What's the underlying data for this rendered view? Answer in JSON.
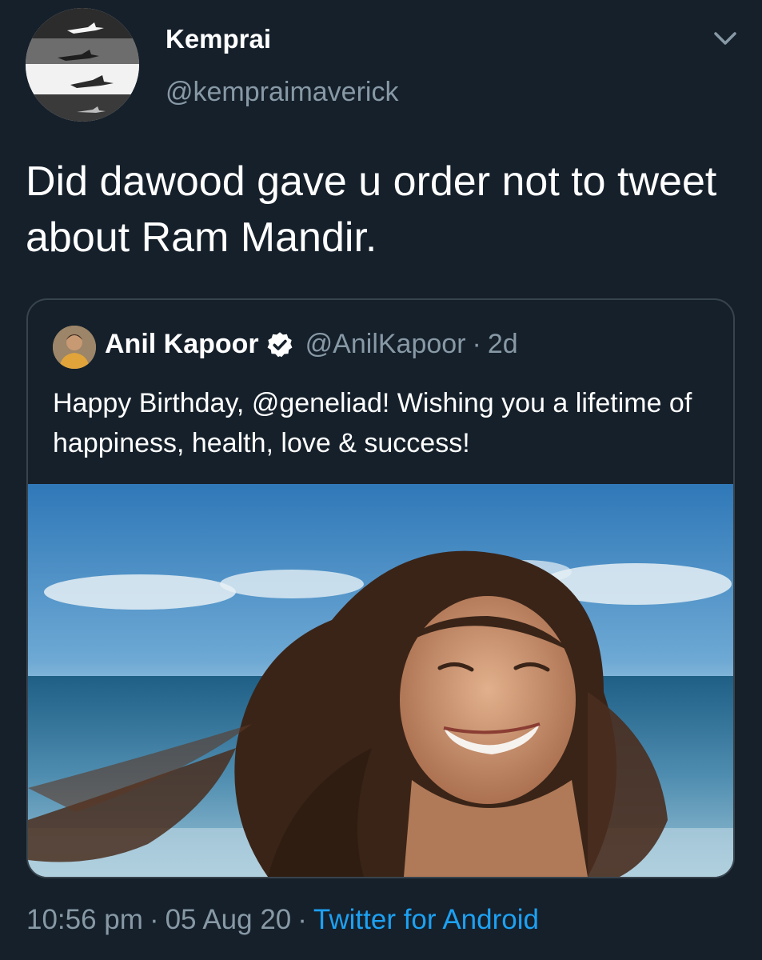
{
  "tweet": {
    "display_name": "Kemprai",
    "handle": "@kempraimaverick",
    "avatar_icon": "fighter-jets-avatar",
    "menu_icon": "chevron-down-icon",
    "text": "Did dawood gave u order not to tweet about Ram Mandir."
  },
  "quoted_tweet": {
    "display_name": "Anil Kapoor",
    "verified_icon": "verified-badge-icon",
    "handle": "@AnilKapoor",
    "separator": "·",
    "time_ago": "2d",
    "text": "Happy Birthday, @geneliad! Wishing you a lifetime of happiness, health, love & success!",
    "media_icon": "photo-woman-laughing-beach"
  },
  "footer": {
    "time": "10:56 pm",
    "separator": "·",
    "date": "05 Aug 20",
    "source": "Twitter for Android"
  },
  "colors": {
    "background": "#15202b",
    "secondary_text": "#8899a6",
    "link": "#1da1f2",
    "border": "#38444d"
  }
}
